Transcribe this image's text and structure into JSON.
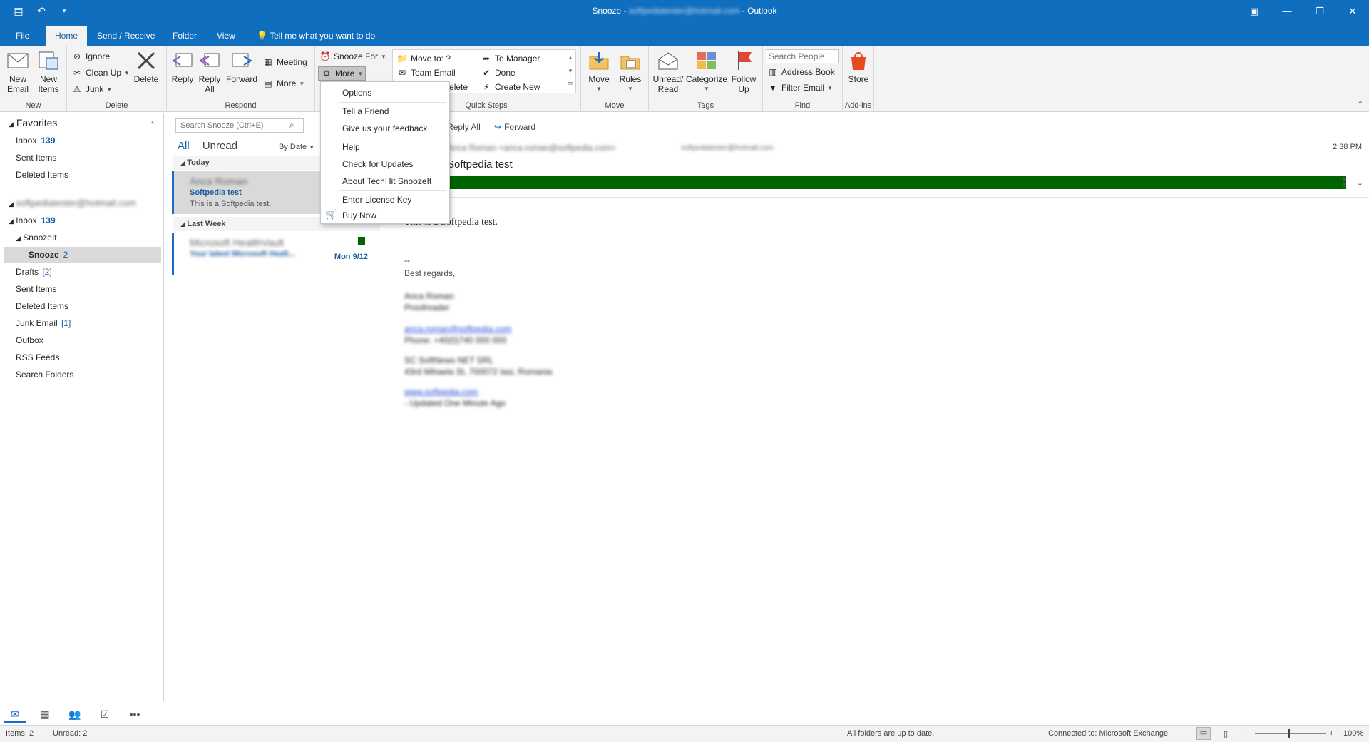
{
  "titlebar": {
    "title_prefix": "Snooze - ",
    "account": "softpediatester@hotmail.com",
    "title_suffix": " - Outlook",
    "minimize": "—",
    "restore": "❐",
    "close": "✕"
  },
  "tabs": [
    "File",
    "Home",
    "Send / Receive",
    "Folder",
    "View",
    "Tell me what you want to do"
  ],
  "ribbon": {
    "new": {
      "new_email": "New Email",
      "new_items": "New Items",
      "label": "New"
    },
    "delete": {
      "ignore": "Ignore",
      "clean_up": "Clean Up",
      "junk": "Junk",
      "delete": "Delete",
      "label": "Delete"
    },
    "respond": {
      "reply": "Reply",
      "reply_all": "Reply All",
      "forward": "Forward",
      "meeting": "Meeting",
      "more": "More",
      "label": "Respond"
    },
    "snooze": {
      "snooze_for": "Snooze For",
      "more": "More"
    },
    "quick_steps": {
      "move_to": "Move to: ?",
      "team_email": "Team Email",
      "reply_delete": "Reply & Delete",
      "to_manager": "To Manager",
      "done": "Done",
      "create_new": "Create New",
      "label": "Quick Steps"
    },
    "move": {
      "move": "Move",
      "rules": "Rules",
      "label": "Move"
    },
    "tags": {
      "unread_read": "Unread/ Read",
      "categorize": "Categorize",
      "follow_up": "Follow Up",
      "label": "Tags"
    },
    "find": {
      "search_people": "Search People",
      "address_book": "Address Book",
      "filter_email": "Filter Email",
      "label": "Find"
    },
    "addins": {
      "store": "Store",
      "label": "Add-ins"
    }
  },
  "folder_pane": {
    "favorites": "Favorites",
    "fav_items": [
      {
        "name": "Inbox",
        "count": "139"
      },
      {
        "name": "Sent Items"
      },
      {
        "name": "Deleted Items"
      }
    ],
    "account": "softpediatester@hotmail.com",
    "inbox": {
      "name": "Inbox",
      "count": "139"
    },
    "snoozeit": "SnoozeIt",
    "snooze": {
      "name": "Snooze",
      "count": "2"
    },
    "folders": [
      {
        "name": "Drafts",
        "count": "[2]"
      },
      {
        "name": "Sent Items"
      },
      {
        "name": "Deleted Items"
      },
      {
        "name": "Junk Email",
        "count": "[1]"
      },
      {
        "name": "Outbox"
      },
      {
        "name": "RSS Feeds"
      },
      {
        "name": "Search Folders"
      }
    ]
  },
  "message_list": {
    "search_placeholder": "Search Snooze (Ctrl+E)",
    "filter_all": "All",
    "filter_unread": "Unread",
    "sort": "By Date",
    "group_today": "Today",
    "group_last_week": "Last Week",
    "mails": [
      {
        "from": "Anca Roman",
        "subject": "Softpedia test",
        "preview": "This is a Softpedia test.",
        "date": ""
      },
      {
        "from": "Microsoft HealthVault",
        "subject": "Your latest Microsoft Healt...",
        "preview": "",
        "date": "Mon 9/12"
      }
    ]
  },
  "reading_pane": {
    "reply_all": "Reply All",
    "forward": "Forward",
    "sender": "Anca Roman <anca.roman@softpedia.com>",
    "to": "softpediatester@hotmail.com",
    "time": "2:38 PM",
    "subject": "Softpedia test",
    "body": "This is a Softpedia test.",
    "sig_dash": "--",
    "sig_regards": "Best regards,",
    "sig_name": "Anca Roman",
    "sig_title": "Proofreader",
    "sig_email": "anca.roman@softpedia.com",
    "sig_phone": "Phone: +40(0)740 000 000",
    "sig_company": "SC SoftNews NET SRL",
    "sig_address": "43rd Mihaela St, 700072 Iasi, Romania",
    "sig_site": "www.softpedia.com",
    "sig_updated": "- Updated One Minute Ago"
  },
  "menu": {
    "items": [
      "Options",
      "Tell a Friend",
      "Give us your feedback",
      "Help",
      "Check for Updates",
      "About TechHit SnoozeIt",
      "Enter License Key",
      "Buy Now"
    ]
  },
  "statusbar": {
    "items": "Items: 2",
    "unread": "Unread: 2",
    "sync": "All folders are up to date.",
    "connection": "Connected to: Microsoft Exchange",
    "zoom": "100%"
  },
  "colors": {
    "accent": "#106ebe",
    "green_category": "#006400",
    "link": "#1b5e9f"
  }
}
